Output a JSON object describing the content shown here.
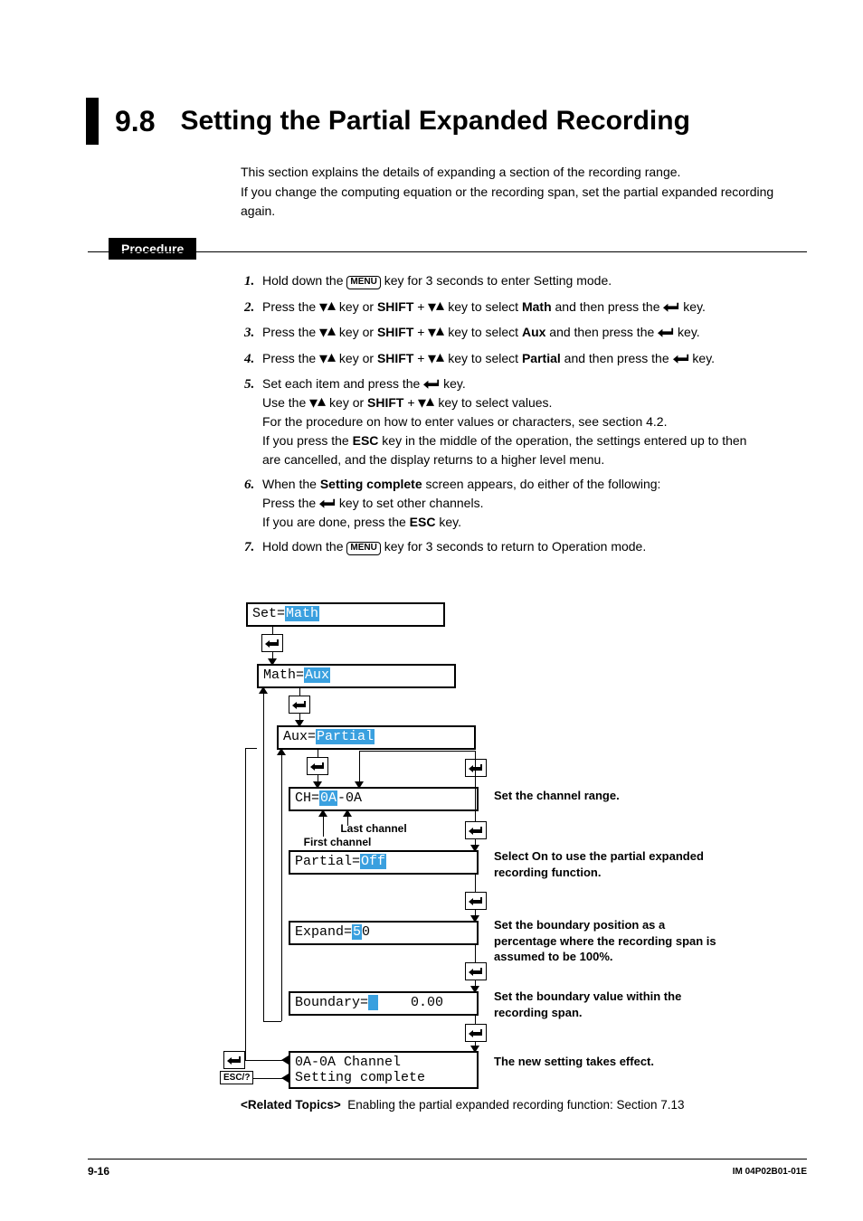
{
  "section": {
    "num": "9.8",
    "title": "Setting the Partial Expanded Recording"
  },
  "intro": "This section explains the details of expanding a section of the recording range.\nIf you change the computing equation or the recording span, set the partial expanded recording again.",
  "proc_label": "Procedure",
  "menu_key": "MENU",
  "steps": {
    "s1a": "Hold down the ",
    "s1b": " key for 3 seconds to enter Setting mode.",
    "s2a": "Press the ",
    "s2b": " key or ",
    "shift": "SHIFT",
    "plus": " + ",
    "s2c": " key to select ",
    "math": "Math",
    "s2d": " and then press the ",
    "s2e": " key.",
    "s3c": " key to select ",
    "aux": "Aux",
    "s3d": " and then press the ",
    "s4c": " key to select ",
    "partial": "Partial",
    "s4d": " and then press the ",
    "s5a": "Set each item and press the ",
    "s5b": " key.",
    "s5c": "Use the ",
    "s5d": " key or ",
    "s5e": " key to select values.",
    "s5f": "For the procedure on how to enter values or characters, see section 4.2.",
    "s5g": "If you press the ",
    "esc": "ESC",
    "s5h": " key in the middle of the operation, the settings entered up to then are cancelled, and the display returns to a higher level menu.",
    "s6a": "When the ",
    "setcomp": "Setting complete",
    "s6b": " screen appears, do either of the following:",
    "s6c": "Press the ",
    "s6d": " key to set other channels.",
    "s6e": "If you are done, press the ",
    "s6f": " key.",
    "s7a": "Hold down the ",
    "s7b": " key for 3 seconds to return to Operation mode."
  },
  "flow": {
    "b1a": "Set=",
    "b1b": "Math",
    "b2a": "Math=",
    "b2b": "Aux",
    "b3a": "Aux=",
    "b3b": "Partial",
    "b4a": "CH=",
    "b4b": "0A",
    "b4c": "-0A",
    "first_ch": "First channel",
    "last_ch": "Last channel",
    "b5a": "Partial=",
    "b5b": "Off",
    "b6a": "Expand=",
    "b6b": "5",
    "b6c": "0",
    "b7a": "Boundary=",
    "b7b": " ",
    "b7c": "    0.00",
    "b8a": "0A-0A Channel",
    "b8b": "Setting complete",
    "esc_label": "ESC/?",
    "lbl_ch": "Set the channel range.",
    "lbl_partial": "Select On to use the partial expanded recording function.",
    "lbl_expand": "Set the boundary position as a percentage where the recording span is assumed to be 100%.",
    "lbl_boundary": "Set the boundary value within the recording span.",
    "lbl_done": "The new setting takes effect."
  },
  "related": {
    "label": "<Related Topics>",
    "text": "  Enabling the partial expanded recording function: Section 7.13"
  },
  "footer": {
    "page": "9-16",
    "doc": "IM 04P02B01-01E"
  }
}
